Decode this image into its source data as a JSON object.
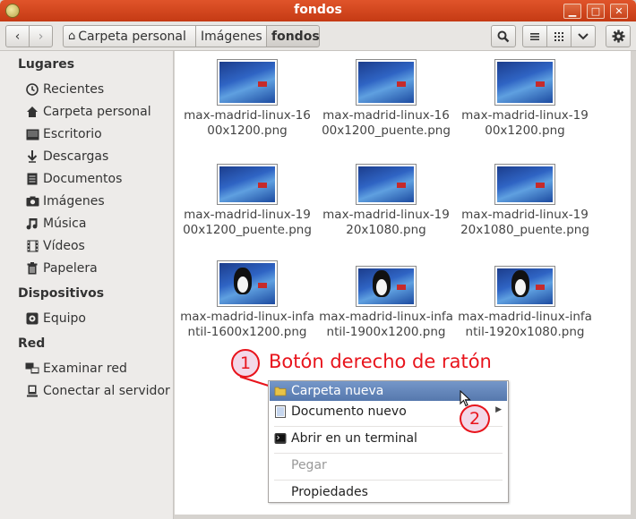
{
  "window": {
    "title": "fondos"
  },
  "toolbar": {
    "back_icon": "chevron-left-icon",
    "forward_icon": "chevron-right-icon",
    "breadcrumbs": [
      {
        "label": "Carpeta personal",
        "icon": "home-icon"
      },
      {
        "label": "Imágenes"
      },
      {
        "label": "fondos"
      }
    ],
    "search_icon": "search-icon",
    "list_view_icon": "list-view-icon",
    "grid_view_icon": "grid-view-icon",
    "view_options_icon": "chevron-down-icon",
    "settings_icon": "gear-icon"
  },
  "sidebar": {
    "sections": [
      {
        "heading": "Lugares",
        "items": [
          {
            "label": "Recientes",
            "icon": "clock-icon"
          },
          {
            "label": "Carpeta personal",
            "icon": "home-icon"
          },
          {
            "label": "Escritorio",
            "icon": "desktop-icon"
          },
          {
            "label": "Descargas",
            "icon": "download-icon"
          },
          {
            "label": "Documentos",
            "icon": "document-icon"
          },
          {
            "label": "Imágenes",
            "icon": "camera-icon"
          },
          {
            "label": "Música",
            "icon": "music-icon"
          },
          {
            "label": "Vídeos",
            "icon": "film-icon"
          },
          {
            "label": "Papelera",
            "icon": "trash-icon"
          }
        ]
      },
      {
        "heading": "Dispositivos",
        "items": [
          {
            "label": "Equipo",
            "icon": "computer-icon"
          }
        ]
      },
      {
        "heading": "Red",
        "items": [
          {
            "label": "Examinar red",
            "icon": "network-icon"
          },
          {
            "label": "Conectar al servidor",
            "icon": "server-icon"
          }
        ]
      }
    ]
  },
  "files": [
    {
      "name": "max-madrid-linux-1600x1200.png",
      "tux": false
    },
    {
      "name": "max-madrid-linux-1600x1200_puente.png",
      "tux": false
    },
    {
      "name": "max-madrid-linux-1900x1200.png",
      "tux": false
    },
    {
      "name": "max-madrid-linux-1900x1200_puente.png",
      "tux": false
    },
    {
      "name": "max-madrid-linux-1920x1080.png",
      "tux": false
    },
    {
      "name": "max-madrid-linux-1920x1080_puente.png",
      "tux": false
    },
    {
      "name": "max-madrid-linux-infantil-1600x1200.png",
      "tux": true
    },
    {
      "name": "max-madrid-linux-infantil-1900x1200.png",
      "tux": true
    },
    {
      "name": "max-madrid-linux-infantil-1920x1080.png",
      "tux": true
    }
  ],
  "annotations": {
    "step1_number": "1",
    "step1_text": "Botón derecho de ratón",
    "step2_number": "2",
    "color": "#e8141c"
  },
  "context_menu": {
    "items": [
      {
        "label": "Carpeta nueva",
        "icon": "folder-icon",
        "state": "hover"
      },
      {
        "label": "Documento nuevo",
        "icon": "document-icon",
        "submenu": true
      },
      {
        "label": "Abrir en un terminal",
        "icon": "terminal-icon"
      },
      {
        "label": "Pegar",
        "state": "disabled"
      },
      {
        "label": "Propiedades"
      }
    ]
  }
}
